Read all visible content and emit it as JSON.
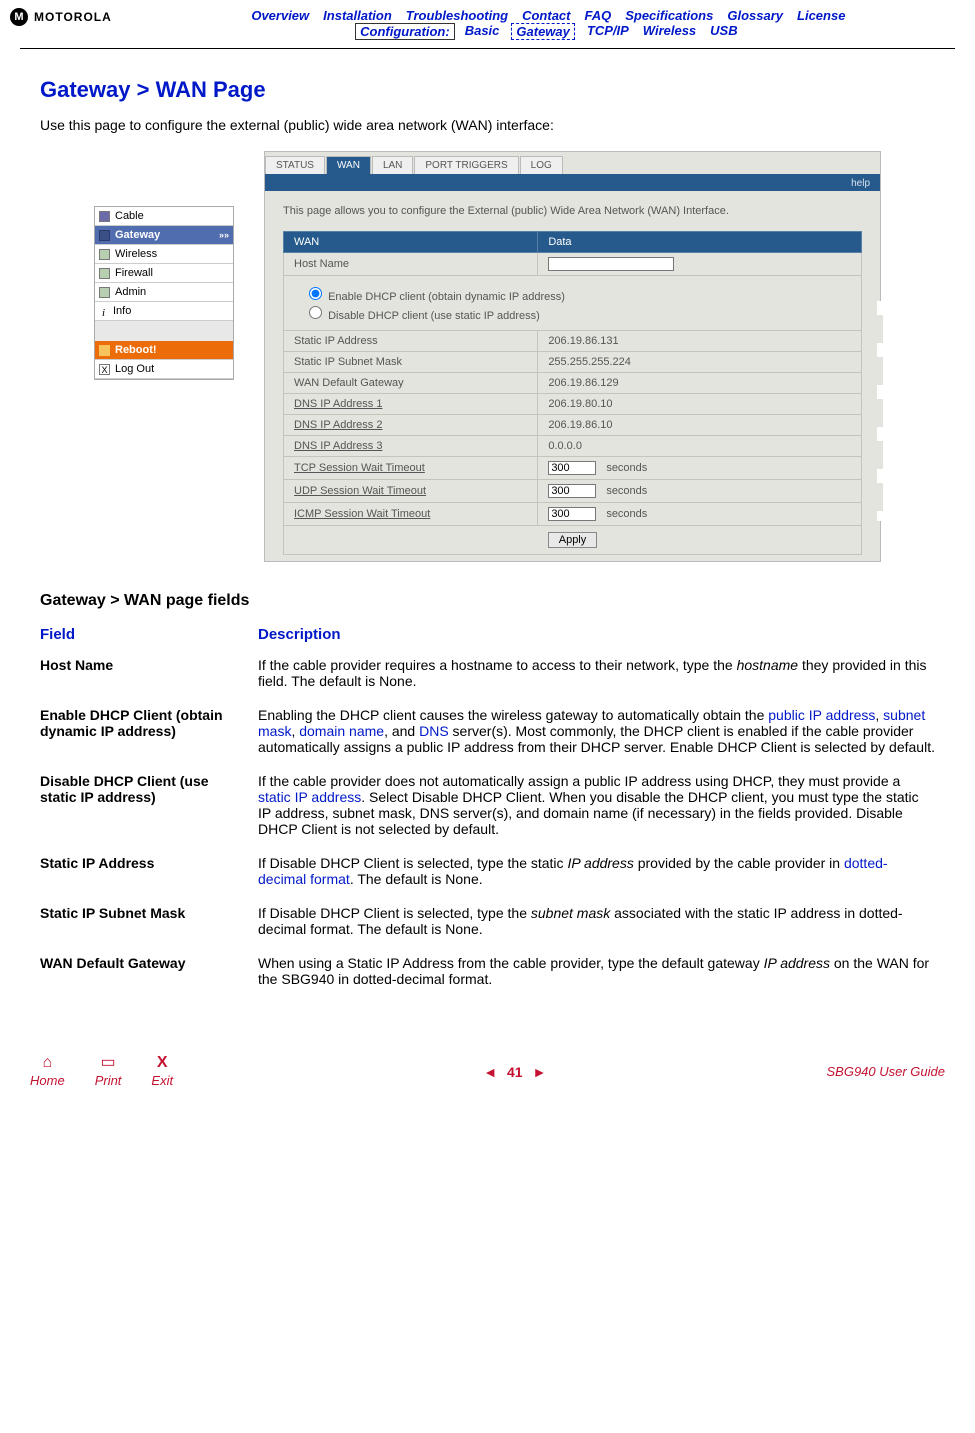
{
  "logo_text": "MOTOROLA",
  "topnav_row1": [
    "Overview",
    "Installation",
    "Troubleshooting",
    "Contact",
    "FAQ",
    "Specifications",
    "Glossary",
    "License"
  ],
  "topnav_conf_label": "Configuration:",
  "topnav_row2": [
    "Basic",
    "Gateway",
    "TCP/IP",
    "Wireless",
    "USB"
  ],
  "topnav_active_conf": "Gateway",
  "page_title": "Gateway > WAN Page",
  "intro": "Use this page to configure the external (public) wide area network (WAN) interface:",
  "sidenav": {
    "items": [
      {
        "label": "Cable",
        "cls": "cable"
      },
      {
        "label": "Gateway",
        "cls": "gateway",
        "chev": "»»"
      },
      {
        "label": "Wireless",
        "cls": ""
      },
      {
        "label": "Firewall",
        "cls": ""
      },
      {
        "label": "Admin",
        "cls": ""
      },
      {
        "label": "Info",
        "cls": "info",
        "icon_text": "i"
      }
    ],
    "reboot_label": "Reboot!",
    "logout_label": "Log Out",
    "logout_icon": "X"
  },
  "config_panel": {
    "tabs": [
      "STATUS",
      "WAN",
      "LAN",
      "PORT TRIGGERS",
      "LOG"
    ],
    "active_tab": "WAN",
    "help_label": "help",
    "description": "This page allows you to configure the External (public) Wide Area Network (WAN) Interface.",
    "header_wan": "WAN",
    "header_data": "Data",
    "rows": {
      "host_name_label": "Host Name",
      "host_name_value": "",
      "enable_dhcp_label": "Enable DHCP client (obtain dynamic IP address)",
      "disable_dhcp_label": "Disable DHCP client (use static IP address)",
      "static_ip_label": "Static IP Address",
      "static_ip_value": "206.19.86.131",
      "subnet_label": "Static IP Subnet Mask",
      "subnet_value": "255.255.255.224",
      "wan_gw_label": "WAN Default Gateway",
      "wan_gw_value": "206.19.86.129",
      "dns1_label": "DNS IP Address 1",
      "dns1_value": "206.19.80.10",
      "dns2_label": "DNS IP Address 2",
      "dns2_value": "206.19.86.10",
      "dns3_label": "DNS IP Address 3",
      "dns3_value": "0.0.0.0",
      "tcp_label": "TCP Session Wait Timeout",
      "tcp_value": "300",
      "udp_label": "UDP Session Wait Timeout",
      "udp_value": "300",
      "icmp_label": "ICMP Session Wait Timeout",
      "icmp_value": "300",
      "seconds_label": "seconds"
    },
    "apply_label": "Apply"
  },
  "section_title": "Gateway > WAN page fields",
  "fields_table": {
    "col_field": "Field",
    "col_desc": "Description",
    "rows": [
      {
        "name": "Host Name",
        "desc_pre": "If the cable provider requires a hostname to access to their network, type the ",
        "desc_em": "hostname",
        "desc_post": " they provided in this field. The default is None."
      }
    ],
    "row_dhcp_enable": {
      "name": "Enable DHCP Client (obtain dynamic IP address)",
      "d1": "Enabling the DHCP client causes the wireless gateway to automatically obtain the ",
      "l1": "public IP address",
      "d2": ", ",
      "l2": "subnet mask",
      "d3": ", ",
      "l3": "domain name",
      "d4": ", and ",
      "l4": "DNS",
      "d5": " server(s). Most commonly, the DHCP client is enabled if the cable provider automatically assigns a public IP address from their DHCP server. Enable DHCP Client is selected by default."
    },
    "row_dhcp_disable": {
      "name": "Disable DHCP Client (use static IP address)",
      "d1": "If the cable provider does not automatically assign a public IP address using DHCP, they must provide a ",
      "l1": "static IP address",
      "d2": ". Select Disable DHCP Client. When you disable the DHCP client, you must type the static IP address, subnet mask, DNS server(s), and domain name (if necessary) in the fields provided. Disable DHCP Client is not selected by default."
    },
    "row_static_ip": {
      "name": "Static IP Address",
      "d1": "If Disable DHCP Client is selected, type the static ",
      "em1": "IP address",
      "d2": " provided by the cable provider in ",
      "l1": "dotted-decimal format",
      "d3": ". The default is None."
    },
    "row_subnet": {
      "name": "Static IP Subnet Mask",
      "d1": "If Disable DHCP Client is selected, type the ",
      "em1": "subnet mask",
      "d2": " associated with the static IP address in dotted-decimal format. The default is None."
    },
    "row_wan_gw": {
      "name": "WAN Default Gateway",
      "d1": "When using a Static IP Address from the cable provider, type the default gateway ",
      "em1": "IP address",
      "d2": " on the WAN for the SBG940 in dotted-decimal format."
    }
  },
  "footer": {
    "home": "Home",
    "print": "Print",
    "exit": "Exit",
    "exit_icon": "X",
    "page_num": "41",
    "prev": "◄",
    "next": "►",
    "guide": "SBG940 User Guide"
  }
}
